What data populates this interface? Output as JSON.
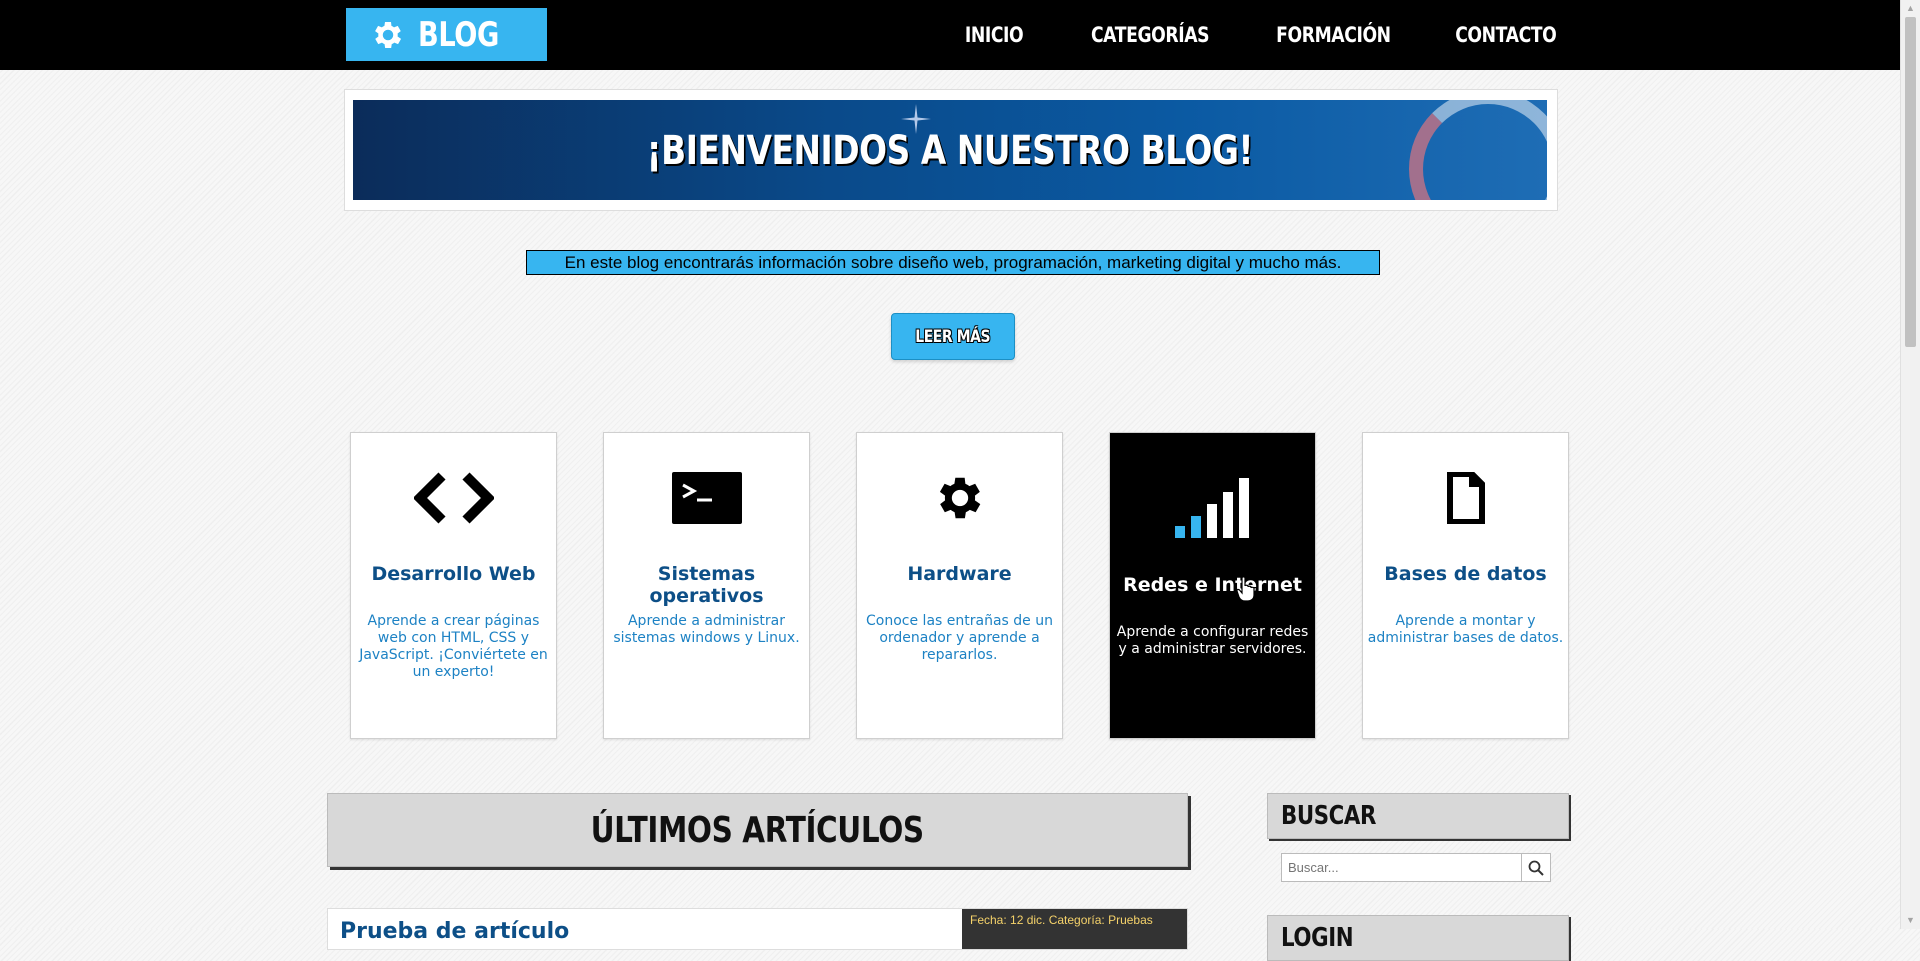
{
  "header": {
    "logo_text": "BLOG",
    "nav": [
      "INICIO",
      "CATEGORÍAS",
      "FORMACIÓN",
      "CONTACTO"
    ]
  },
  "banner": {
    "title": "¡BIENVENIDOS A NUESTRO BLOG!"
  },
  "intro_text": "En este blog encontrarás información sobre diseño web, programación, marketing digital y mucho más.",
  "read_more_label": "LEER MÁS",
  "categories": [
    {
      "title": "Desarrollo Web",
      "text": "Aprende a crear páginas web con HTML, CSS y JavaScript. ¡Conviértete en un experto!",
      "icon": "code-icon"
    },
    {
      "title": "Sistemas operativos",
      "text": "Aprende a administrar sistemas windows y Linux.",
      "icon": "terminal-icon"
    },
    {
      "title": "Hardware",
      "text": "Conoce las entrañas de un ordenador y aprende a repararlos.",
      "icon": "gear-icon"
    },
    {
      "title": "Redes e Internet",
      "text": "Aprende a configurar redes y a administrar servidores.",
      "icon": "signal-icon"
    },
    {
      "title": "Bases de datos",
      "text": "Aprende a montar y administrar bases de datos.",
      "icon": "document-icon"
    }
  ],
  "latest": {
    "heading": "ÚLTIMOS ARTÍCULOS",
    "first_article": {
      "title": "Prueba de artículo",
      "meta": "Fecha: 12 dic.   Categoría: Pruebas"
    }
  },
  "sidebar": {
    "search_heading": "BUSCAR",
    "search_placeholder": "Buscar...",
    "next_heading": "LOGIN"
  },
  "colors": {
    "accent": "#37b5f0",
    "dark": "#000000",
    "title_blue": "#0d4f87",
    "text_blue": "#1d82c4"
  }
}
